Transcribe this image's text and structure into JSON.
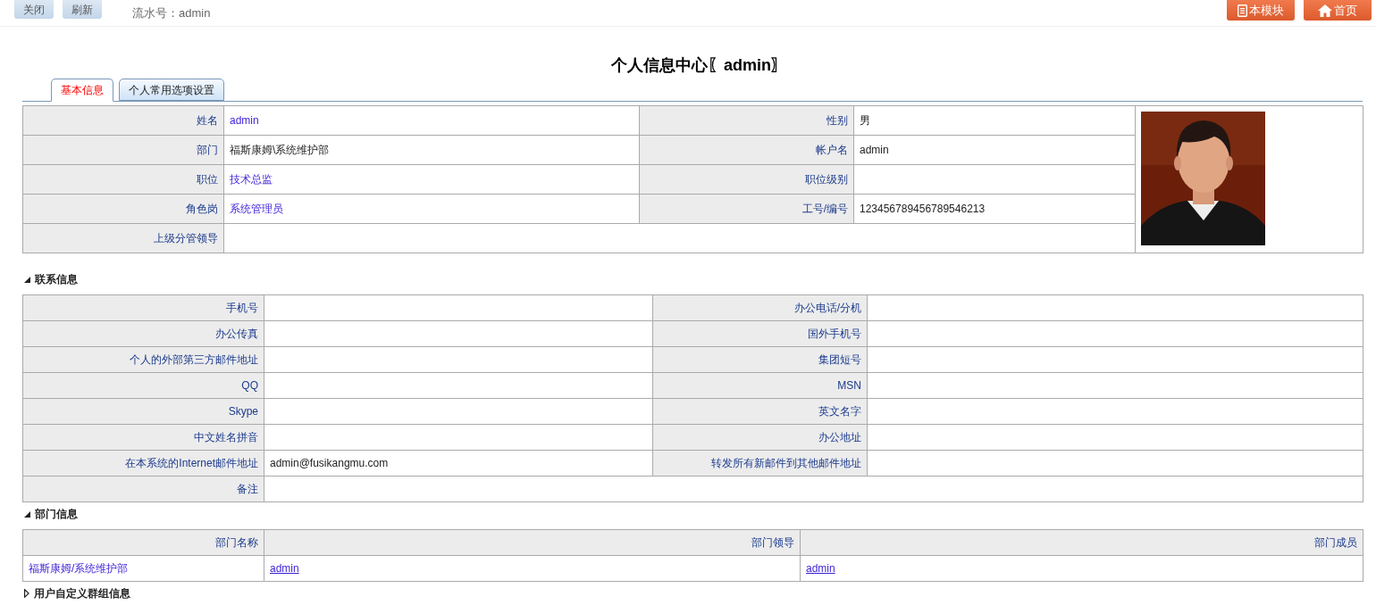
{
  "toolbar": {
    "buttons": [
      "关闭",
      "刷新"
    ],
    "serial": "流水号：admin",
    "module_button": "本模块",
    "home_button": "首页"
  },
  "title": "个人信息中心〖admin〗",
  "tabs": [
    {
      "label": "基本信息",
      "selected": true
    },
    {
      "label": "个人常用选项设置",
      "selected": false
    }
  ],
  "basic_info": {
    "rows": [
      {
        "left": {
          "label": "姓名",
          "value": "admin",
          "linked": true
        },
        "right": {
          "label": "性别",
          "value": "男",
          "linked": false
        }
      },
      {
        "left": {
          "label": "部门",
          "value": "福斯康姆\\系统维护部",
          "linked": false
        },
        "right": {
          "label": "帐户名",
          "value": "admin",
          "linked": false
        }
      },
      {
        "left": {
          "label": "职位",
          "value": "技术总监",
          "linked": true
        },
        "right": {
          "label": "职位级别"
        }
      },
      {
        "left": {
          "label": "角色岗",
          "value": "系统管理员",
          "linked": true
        },
        "right": {
          "label": "工号/编号",
          "value": "123456789456789546213",
          "linked": false
        }
      },
      {
        "left": {
          "label": "上级分管领导"
        }
      }
    ]
  },
  "sections": [
    {
      "title": "联系信息",
      "expanded": true,
      "kind": "fields",
      "rows": [
        {
          "left": {
            "label": "手机号"
          },
          "right": {
            "label": "办公电话/分机"
          }
        },
        {
          "left": {
            "label": "办公传真"
          },
          "right": {
            "label": "国外手机号"
          }
        },
        {
          "left": {
            "label": "个人的外部第三方邮件地址"
          },
          "right": {
            "label": "集团短号"
          }
        },
        {
          "left": {
            "label": "QQ"
          },
          "right": {
            "label": "MSN"
          }
        },
        {
          "left": {
            "label": "Skype"
          },
          "right": {
            "label": "英文名字"
          }
        },
        {
          "left": {
            "label": "中文姓名拼音"
          },
          "right": {
            "label": "办公地址"
          }
        },
        {
          "left": {
            "label": "在本系统的Internet邮件地址",
            "value": "admin@fusikangmu.com",
            "linked": false
          },
          "right": {
            "label": "转发所有新邮件到其他邮件地址"
          }
        },
        {
          "left": {
            "label": "备注"
          }
        }
      ]
    },
    {
      "title": "部门信息",
      "expanded": true,
      "kind": "table",
      "columns": [
        "部门名称",
        "部门领导",
        "部门成员"
      ],
      "rows": [
        [
          "福斯康姆/系统维护部",
          "admin",
          "admin"
        ]
      ]
    },
    {
      "title": "用户自定义群组信息",
      "expanded": false
    }
  ]
}
